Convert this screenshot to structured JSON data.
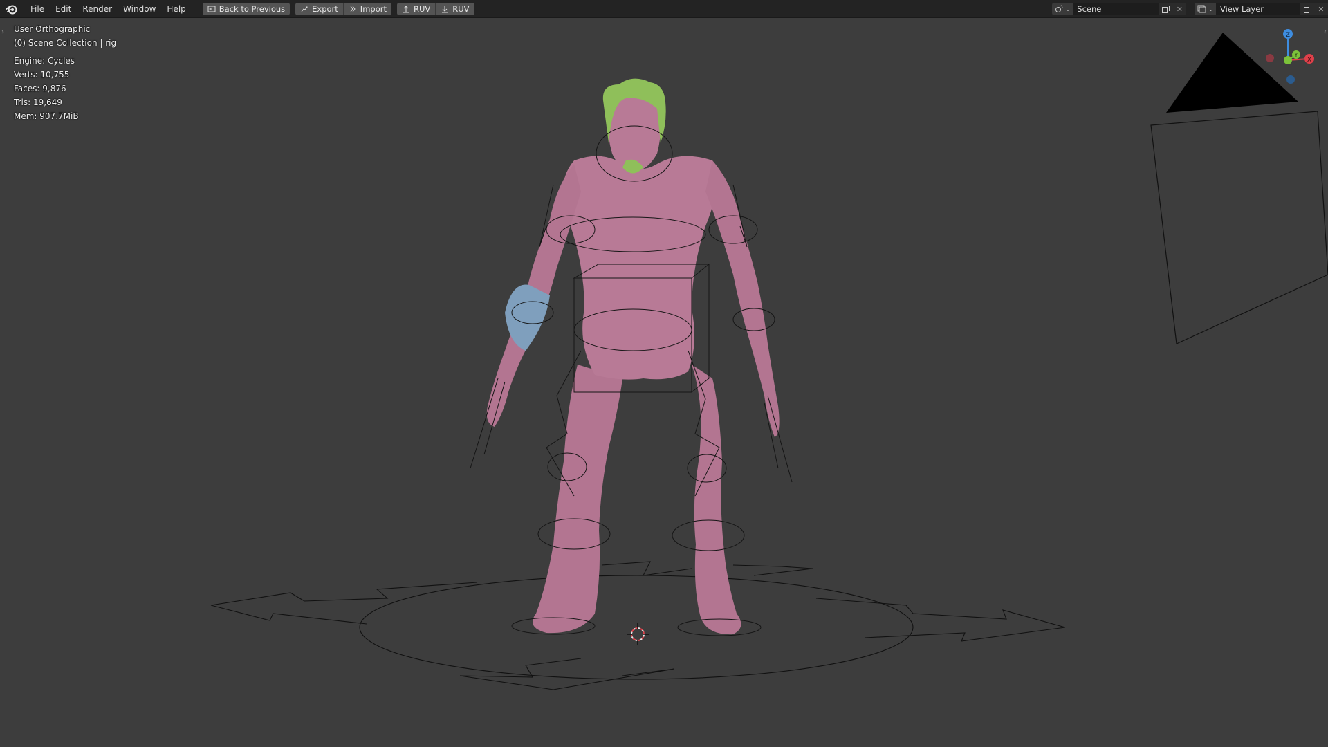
{
  "menu": {
    "items": [
      "File",
      "Edit",
      "Render",
      "Window",
      "Help"
    ]
  },
  "toolbar": {
    "back_label": "Back to Previous",
    "export_label": "Export",
    "import_label": "Import",
    "ruv_up_label": "RUV",
    "ruv_down_label": "RUV"
  },
  "scene": {
    "name": "Scene"
  },
  "view_layer": {
    "name": "View Layer"
  },
  "viewport": {
    "view_name": "User Orthographic",
    "collection": "(0) Scene Collection | rig",
    "stats": {
      "engine": "Engine: Cycles",
      "verts": "Verts: 10,755",
      "faces": "Faces: 9,876",
      "tris": "Tris: 19,649",
      "mem": "Mem: 907.7MiB"
    }
  },
  "gizmo": {
    "z": "Z",
    "y": "Y",
    "x": "X"
  },
  "colors": {
    "header_bg": "#232323",
    "viewport_bg": "#3d3d3d",
    "button_bg": "#545454",
    "skin": "#b77a95",
    "hair": "#8fbf5a",
    "arm_band": "#7fa0bf",
    "axis_x": "#e0404a",
    "axis_y": "#7cc23a",
    "axis_z": "#3e8de0"
  },
  "icons": [
    "blender-logo-icon",
    "back-icon",
    "export-icon",
    "import-icon",
    "upload-icon",
    "download-icon",
    "scene-icon",
    "copy-icon",
    "close-icon",
    "view-layer-icon",
    "3d-cursor-icon",
    "camera-icon"
  ]
}
